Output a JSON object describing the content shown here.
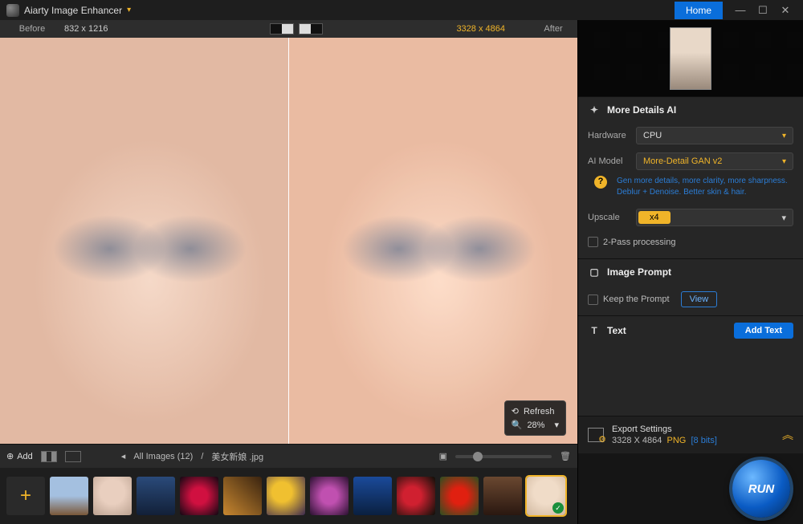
{
  "titlebar": {
    "app_name": "Aiarty Image Enhancer",
    "home": "Home"
  },
  "preview_hdr": {
    "before": "Before",
    "dim1": "832 x 1216",
    "dim2": "3328 x 4864",
    "after": "After"
  },
  "zoom": {
    "refresh": "Refresh",
    "pct": "28%"
  },
  "bottombar": {
    "add": "Add",
    "all_images": "All Images (12)",
    "filename": "美女新娘 .jpg"
  },
  "panel": {
    "more_details_title": "More Details AI",
    "hardware_lbl": "Hardware",
    "hardware_val": "CPU",
    "model_lbl": "AI Model",
    "model_val": "More-Detail GAN v2",
    "model_desc": "Gen more details, more clarity, more sharpness. Deblur + Denoise. Better skin & hair.",
    "upscale_lbl": "Upscale",
    "upscale_val": "x4",
    "two_pass": "2-Pass processing",
    "image_prompt_title": "Image Prompt",
    "keep_prompt": "Keep the Prompt",
    "view_btn": "View",
    "text_title": "Text",
    "add_text": "Add Text"
  },
  "export": {
    "title": "Export Settings",
    "dim": "3328 X 4864",
    "fmt": "PNG",
    "bits": "[8 bits]"
  },
  "run": {
    "label": "RUN"
  }
}
